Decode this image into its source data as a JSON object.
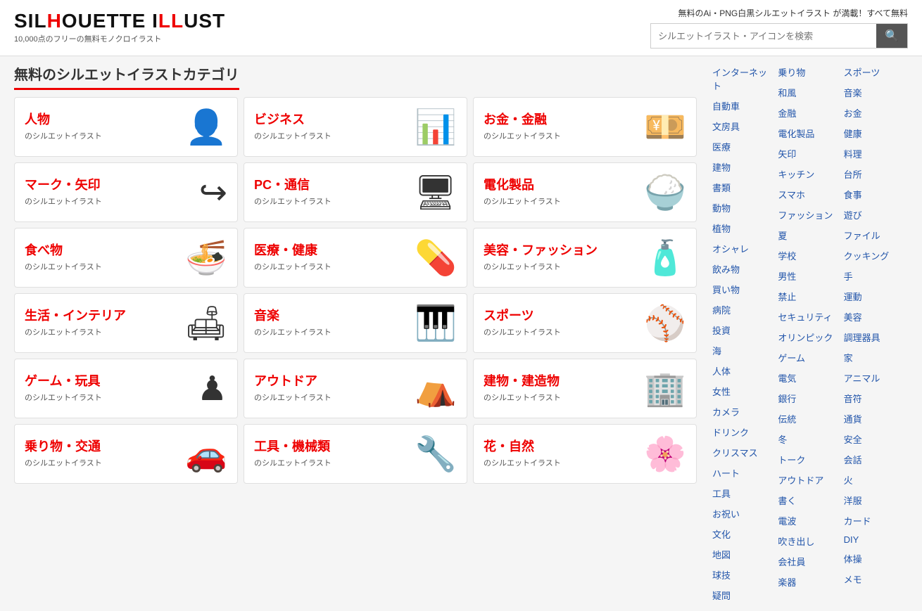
{
  "header": {
    "logo_title": "SILHOUETTE ILLUST",
    "logo_sub": "10,000点のフリーの無料モノクロイラスト",
    "tagline": "無料のAi・PNG白黒シルエットイラスト が満載！すべて無料",
    "search_placeholder": "シルエットイラスト・アイコンを検索",
    "search_icon": "🔍"
  },
  "content": {
    "heading": "無料のシルエットイラストカテゴリ",
    "categories": [
      {
        "title": "人物",
        "sub": "のシルエットイラスト",
        "icon": "👤"
      },
      {
        "title": "ビジネス",
        "sub": "のシルエットイラスト",
        "icon": "📊"
      },
      {
        "title": "お金・金融",
        "sub": "のシルエットイラスト",
        "icon": "💴"
      },
      {
        "title": "マーク・矢印",
        "sub": "のシルエットイラスト",
        "icon": "↪"
      },
      {
        "title": "PC・通信",
        "sub": "のシルエットイラスト",
        "icon": "🖥"
      },
      {
        "title": "電化製品",
        "sub": "のシルエットイラスト",
        "icon": "🍚"
      },
      {
        "title": "食べ物",
        "sub": "のシルエットイラスト",
        "icon": "🍜"
      },
      {
        "title": "医療・健康",
        "sub": "のシルエットイラスト",
        "icon": "💊"
      },
      {
        "title": "美容・ファッション",
        "sub": "のシルエットイラスト",
        "icon": "🧴"
      },
      {
        "title": "生活・インテリア",
        "sub": "のシルエットイラスト",
        "icon": "🛋"
      },
      {
        "title": "音楽",
        "sub": "のシルエットイラスト",
        "icon": "🎹"
      },
      {
        "title": "スポーツ",
        "sub": "のシルエットイラスト",
        "icon": "⚾"
      },
      {
        "title": "ゲーム・玩具",
        "sub": "のシルエットイラスト",
        "icon": "♟"
      },
      {
        "title": "アウトドア",
        "sub": "のシルエットイラスト",
        "icon": "⛺"
      },
      {
        "title": "建物・建造物",
        "sub": "のシルエットイラスト",
        "icon": "🏢"
      },
      {
        "title": "乗り物・交通",
        "sub": "のシルエットイラスト",
        "icon": "🚗"
      },
      {
        "title": "工具・機械類",
        "sub": "のシルエットイラスト",
        "icon": "🔧"
      },
      {
        "title": "花・自然",
        "sub": "のシルエットイラスト",
        "icon": "🌸"
      }
    ]
  },
  "sidebar": {
    "col1": [
      "インターネット",
      "自動車",
      "文房具",
      "医療",
      "建物",
      "書類",
      "動物",
      "植物",
      "オシャレ",
      "飲み物",
      "買い物",
      "病院",
      "投資",
      "海",
      "人体",
      "女性",
      "カメラ",
      "ドリンク",
      "クリスマス",
      "ハート",
      "工具",
      "お祝い",
      "文化",
      "地図",
      "球技",
      "疑問"
    ],
    "col2": [
      "乗り物",
      "和風",
      "金融",
      "電化製品",
      "矢印",
      "キッチン",
      "スマホ",
      "ファッション",
      "夏",
      "学校",
      "男性",
      "禁止",
      "セキュリティ",
      "オリンピック",
      "ゲーム",
      "電気",
      "銀行",
      "伝統",
      "冬",
      "トーク",
      "アウトドア",
      "書く",
      "電波",
      "吹き出し",
      "会社員",
      "楽器"
    ],
    "col3": [
      "スポーツ",
      "音楽",
      "お金",
      "健康",
      "料理",
      "台所",
      "食事",
      "遊び",
      "ファイル",
      "クッキング",
      "手",
      "運動",
      "美容",
      "調理器具",
      "家",
      "アニマル",
      "音符",
      "通貨",
      "安全",
      "会話",
      "火",
      "洋服",
      "カード",
      "DIY",
      "体操",
      "メモ"
    ]
  }
}
